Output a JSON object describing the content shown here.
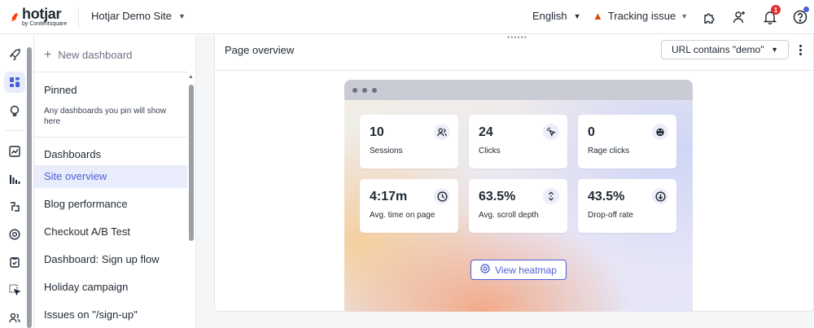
{
  "header": {
    "logo_text": "hotjar",
    "logo_sub": "by Contentsquare",
    "site_name": "Hotjar Demo Site",
    "language": "English",
    "tracking_label": "Tracking issue",
    "notification_count": "1"
  },
  "sidebar": {
    "new_dashboard": "New dashboard",
    "pinned_title": "Pinned",
    "pinned_desc": "Any dashboards you pin will show here",
    "dashboards_title": "Dashboards",
    "items": [
      {
        "label": "Site overview"
      },
      {
        "label": "Blog performance"
      },
      {
        "label": "Checkout A/B Test"
      },
      {
        "label": "Dashboard: Sign up flow"
      },
      {
        "label": "Holiday campaign"
      },
      {
        "label": "Issues on \"/sign-up\""
      }
    ]
  },
  "main": {
    "title": "Page overview",
    "filter": "URL contains \"demo\"",
    "metrics": [
      {
        "value": "10",
        "label": "Sessions",
        "icon": "users-icon"
      },
      {
        "value": "24",
        "label": "Clicks",
        "icon": "click-icon"
      },
      {
        "value": "0",
        "label": "Rage clicks",
        "icon": "angry-face-icon"
      },
      {
        "value": "4:17m",
        "label": "Avg. time on page",
        "icon": "clock-icon"
      },
      {
        "value": "63.5%",
        "label": "Avg. scroll depth",
        "icon": "scroll-icon"
      },
      {
        "value": "43.5%",
        "label": "Drop-off rate",
        "icon": "arrow-down-circle-icon"
      }
    ],
    "heatmap_button": "View heatmap"
  },
  "colors": {
    "accent": "#4c5fd5",
    "brand": "#ff3c00",
    "warning": "#d9480f",
    "badge": "#e03131"
  }
}
